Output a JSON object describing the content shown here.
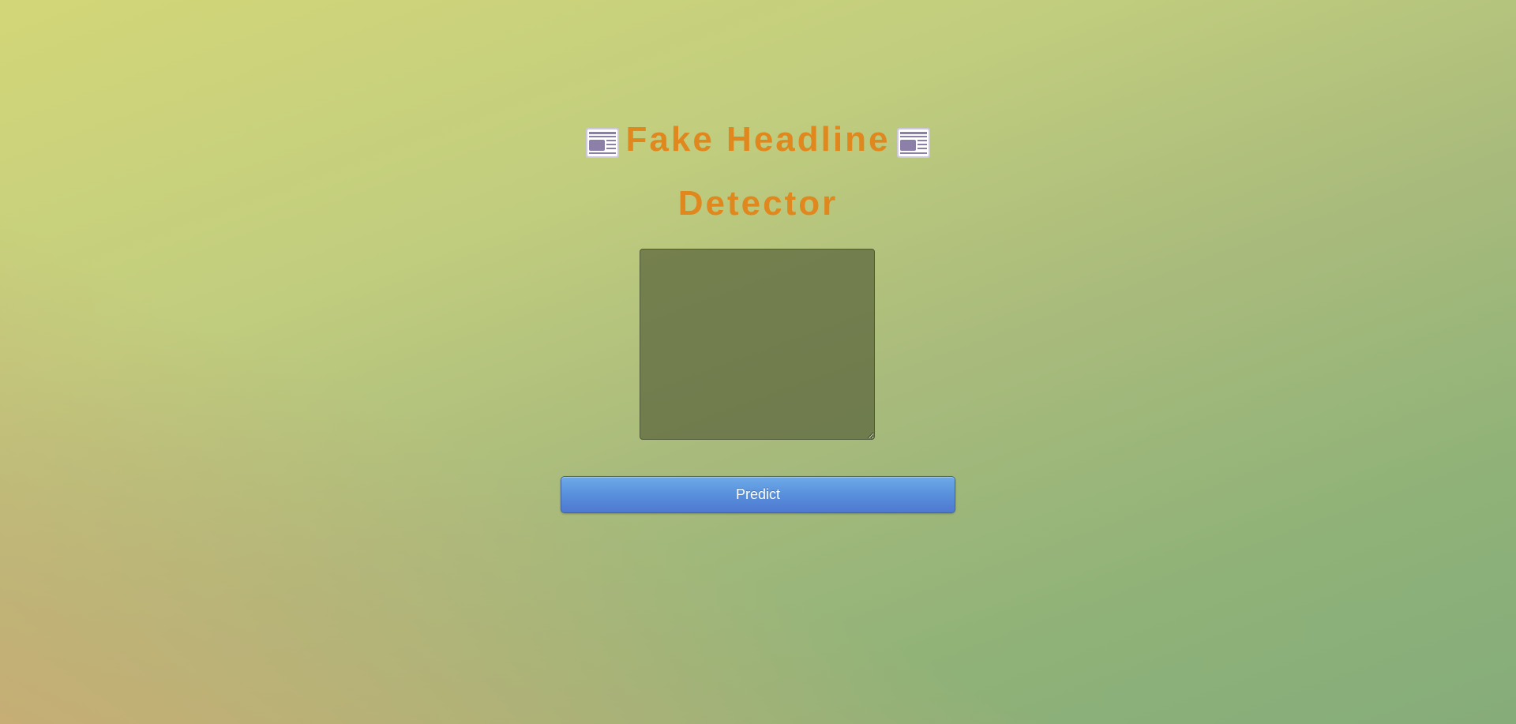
{
  "app": {
    "title_line1": "Fake Headline",
    "title_line2": "Detector",
    "title_icon": "newspaper-icon",
    "accent_color": "#e0871e"
  },
  "form": {
    "headline_input_value": "",
    "predict_label": "Predict"
  },
  "colors": {
    "button": "#5890dc",
    "textarea_bg": "#7a8656"
  }
}
